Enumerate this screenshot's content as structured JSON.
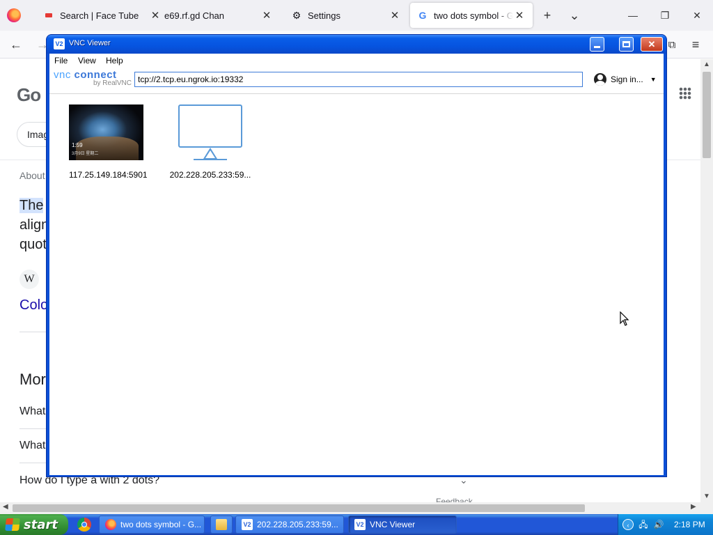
{
  "browser": {
    "tabs": [
      {
        "label": "Search | Face Tube",
        "icon": "video-favicon"
      },
      {
        "label": "e69.rf.gd Chan",
        "icon": "none"
      },
      {
        "label": "Settings",
        "icon": "gear-icon"
      },
      {
        "label": "two dots symbol - Google Search",
        "icon": "google-favicon",
        "active": true
      }
    ],
    "new_tab_symbol": "+",
    "list_tabs_symbol": "⌄"
  },
  "google_page": {
    "logo": "Go",
    "chip_label": "Imag",
    "about": "About",
    "snippet_lines": [
      "The",
      "align",
      "quot"
    ],
    "wiki_symbol": "W",
    "result_link": "Colo",
    "more_heading": "Mor",
    "questions": [
      "What",
      "What",
      "How do I type a with 2 dots?"
    ],
    "feedback": "Feedback"
  },
  "vnc": {
    "title": "VNC Viewer",
    "title_icon": "V2",
    "menu": [
      "File",
      "View",
      "Help"
    ],
    "brand_line1_a": "vnc",
    "brand_line1_b": "connect",
    "brand_line2": "by RealVNC",
    "address_value": "tcp://2.tcp.eu.ngrok.io:19332",
    "sign_in": "Sign in...",
    "connections": [
      {
        "label": "117.25.149.184:5901",
        "thumb_time": "1:59",
        "thumb_date": "3月9日 星期二"
      },
      {
        "label": "202.228.205.233:59..."
      }
    ]
  },
  "taskbar": {
    "start_label": "start",
    "tasks": [
      {
        "label": "two dots symbol - G...",
        "icon_color": "#ff7139"
      },
      {
        "label": "202.228.205.233:59...",
        "icon_color": "#ffffff"
      },
      {
        "label": "VNC Viewer",
        "icon_color": "#ffffff",
        "pressed": true
      }
    ],
    "clock": "2:18 PM"
  },
  "colors": {
    "xp_title_blue": "#0a5ee8",
    "xp_taskbar_blue": "#2157d7",
    "start_green": "#3c9a3c",
    "google_link": "#1a0dab"
  }
}
